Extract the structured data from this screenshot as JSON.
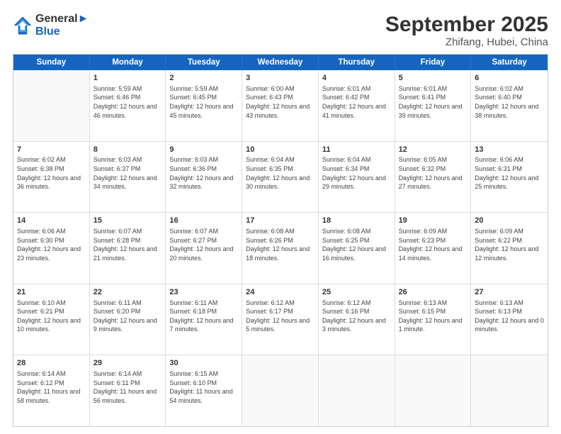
{
  "logo": {
    "line1": "General",
    "line2": "Blue"
  },
  "title": "September 2025",
  "subtitle": "Zhifang, Hubei, China",
  "header_days": [
    "Sunday",
    "Monday",
    "Tuesday",
    "Wednesday",
    "Thursday",
    "Friday",
    "Saturday"
  ],
  "weeks": [
    [
      {
        "day": "",
        "sunrise": "",
        "sunset": "",
        "daylight": ""
      },
      {
        "day": "1",
        "sunrise": "Sunrise: 5:59 AM",
        "sunset": "Sunset: 6:46 PM",
        "daylight": "Daylight: 12 hours and 46 minutes."
      },
      {
        "day": "2",
        "sunrise": "Sunrise: 5:59 AM",
        "sunset": "Sunset: 6:45 PM",
        "daylight": "Daylight: 12 hours and 45 minutes."
      },
      {
        "day": "3",
        "sunrise": "Sunrise: 6:00 AM",
        "sunset": "Sunset: 6:43 PM",
        "daylight": "Daylight: 12 hours and 43 minutes."
      },
      {
        "day": "4",
        "sunrise": "Sunrise: 6:01 AM",
        "sunset": "Sunset: 6:42 PM",
        "daylight": "Daylight: 12 hours and 41 minutes."
      },
      {
        "day": "5",
        "sunrise": "Sunrise: 6:01 AM",
        "sunset": "Sunset: 6:41 PM",
        "daylight": "Daylight: 12 hours and 39 minutes."
      },
      {
        "day": "6",
        "sunrise": "Sunrise: 6:02 AM",
        "sunset": "Sunset: 6:40 PM",
        "daylight": "Daylight: 12 hours and 38 minutes."
      }
    ],
    [
      {
        "day": "7",
        "sunrise": "Sunrise: 6:02 AM",
        "sunset": "Sunset: 6:38 PM",
        "daylight": "Daylight: 12 hours and 36 minutes."
      },
      {
        "day": "8",
        "sunrise": "Sunrise: 6:03 AM",
        "sunset": "Sunset: 6:37 PM",
        "daylight": "Daylight: 12 hours and 34 minutes."
      },
      {
        "day": "9",
        "sunrise": "Sunrise: 6:03 AM",
        "sunset": "Sunset: 6:36 PM",
        "daylight": "Daylight: 12 hours and 32 minutes."
      },
      {
        "day": "10",
        "sunrise": "Sunrise: 6:04 AM",
        "sunset": "Sunset: 6:35 PM",
        "daylight": "Daylight: 12 hours and 30 minutes."
      },
      {
        "day": "11",
        "sunrise": "Sunrise: 6:04 AM",
        "sunset": "Sunset: 6:34 PM",
        "daylight": "Daylight: 12 hours and 29 minutes."
      },
      {
        "day": "12",
        "sunrise": "Sunrise: 6:05 AM",
        "sunset": "Sunset: 6:32 PM",
        "daylight": "Daylight: 12 hours and 27 minutes."
      },
      {
        "day": "13",
        "sunrise": "Sunrise: 6:06 AM",
        "sunset": "Sunset: 6:31 PM",
        "daylight": "Daylight: 12 hours and 25 minutes."
      }
    ],
    [
      {
        "day": "14",
        "sunrise": "Sunrise: 6:06 AM",
        "sunset": "Sunset: 6:30 PM",
        "daylight": "Daylight: 12 hours and 23 minutes."
      },
      {
        "day": "15",
        "sunrise": "Sunrise: 6:07 AM",
        "sunset": "Sunset: 6:28 PM",
        "daylight": "Daylight: 12 hours and 21 minutes."
      },
      {
        "day": "16",
        "sunrise": "Sunrise: 6:07 AM",
        "sunset": "Sunset: 6:27 PM",
        "daylight": "Daylight: 12 hours and 20 minutes."
      },
      {
        "day": "17",
        "sunrise": "Sunrise: 6:08 AM",
        "sunset": "Sunset: 6:26 PM",
        "daylight": "Daylight: 12 hours and 18 minutes."
      },
      {
        "day": "18",
        "sunrise": "Sunrise: 6:08 AM",
        "sunset": "Sunset: 6:25 PM",
        "daylight": "Daylight: 12 hours and 16 minutes."
      },
      {
        "day": "19",
        "sunrise": "Sunrise: 6:09 AM",
        "sunset": "Sunset: 6:23 PM",
        "daylight": "Daylight: 12 hours and 14 minutes."
      },
      {
        "day": "20",
        "sunrise": "Sunrise: 6:09 AM",
        "sunset": "Sunset: 6:22 PM",
        "daylight": "Daylight: 12 hours and 12 minutes."
      }
    ],
    [
      {
        "day": "21",
        "sunrise": "Sunrise: 6:10 AM",
        "sunset": "Sunset: 6:21 PM",
        "daylight": "Daylight: 12 hours and 10 minutes."
      },
      {
        "day": "22",
        "sunrise": "Sunrise: 6:11 AM",
        "sunset": "Sunset: 6:20 PM",
        "daylight": "Daylight: 12 hours and 9 minutes."
      },
      {
        "day": "23",
        "sunrise": "Sunrise: 6:11 AM",
        "sunset": "Sunset: 6:18 PM",
        "daylight": "Daylight: 12 hours and 7 minutes."
      },
      {
        "day": "24",
        "sunrise": "Sunrise: 6:12 AM",
        "sunset": "Sunset: 6:17 PM",
        "daylight": "Daylight: 12 hours and 5 minutes."
      },
      {
        "day": "25",
        "sunrise": "Sunrise: 6:12 AM",
        "sunset": "Sunset: 6:16 PM",
        "daylight": "Daylight: 12 hours and 3 minutes."
      },
      {
        "day": "26",
        "sunrise": "Sunrise: 6:13 AM",
        "sunset": "Sunset: 6:15 PM",
        "daylight": "Daylight: 12 hours and 1 minute."
      },
      {
        "day": "27",
        "sunrise": "Sunrise: 6:13 AM",
        "sunset": "Sunset: 6:13 PM",
        "daylight": "Daylight: 12 hours and 0 minutes."
      }
    ],
    [
      {
        "day": "28",
        "sunrise": "Sunrise: 6:14 AM",
        "sunset": "Sunset: 6:12 PM",
        "daylight": "Daylight: 11 hours and 58 minutes."
      },
      {
        "day": "29",
        "sunrise": "Sunrise: 6:14 AM",
        "sunset": "Sunset: 6:11 PM",
        "daylight": "Daylight: 11 hours and 56 minutes."
      },
      {
        "day": "30",
        "sunrise": "Sunrise: 6:15 AM",
        "sunset": "Sunset: 6:10 PM",
        "daylight": "Daylight: 11 hours and 54 minutes."
      },
      {
        "day": "",
        "sunrise": "",
        "sunset": "",
        "daylight": ""
      },
      {
        "day": "",
        "sunrise": "",
        "sunset": "",
        "daylight": ""
      },
      {
        "day": "",
        "sunrise": "",
        "sunset": "",
        "daylight": ""
      },
      {
        "day": "",
        "sunrise": "",
        "sunset": "",
        "daylight": ""
      }
    ]
  ]
}
